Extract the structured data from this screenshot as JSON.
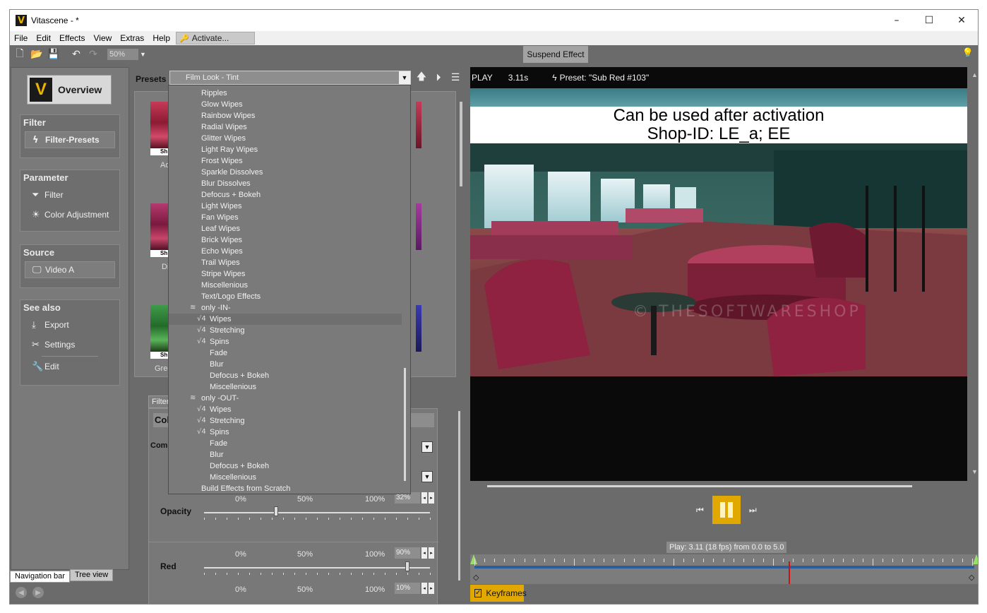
{
  "window": {
    "title": "Vitascene - *",
    "logo": "V",
    "controls": [
      "–",
      "☐",
      "✕"
    ]
  },
  "menu": [
    "File",
    "Edit",
    "Effects",
    "View",
    "Extras",
    "Help"
  ],
  "activate_label": "Activate...",
  "toolbar": {
    "zoom": "50%",
    "suspend_label": "Suspend Effect"
  },
  "nav": {
    "overview_label": "Overview",
    "groups": {
      "filter": {
        "title": "Filter",
        "items": [
          "Filter-Presets"
        ]
      },
      "parameter": {
        "title": "Parameter",
        "items": [
          "Filter",
          "Color Adjustment"
        ]
      },
      "source": {
        "title": "Source",
        "items": [
          "Video A"
        ]
      },
      "see_also": {
        "title": "See also",
        "items": [
          "Export",
          "Settings",
          "Edit"
        ]
      }
    },
    "tabs": [
      "Navigation bar",
      "Tree view"
    ]
  },
  "presets": {
    "label": "Presets",
    "selected": "Film Look - Tint",
    "thumb_caption": "Sh",
    "thumb_names": [
      "Ad",
      "Di",
      "Gree"
    ]
  },
  "dropdown": {
    "items": [
      {
        "text": "Ripples",
        "indent": 1
      },
      {
        "text": "Glow Wipes",
        "indent": 1
      },
      {
        "text": "Rainbow Wipes",
        "indent": 1
      },
      {
        "text": "Radial Wipes",
        "indent": 1
      },
      {
        "text": "Glitter Wipes",
        "indent": 1
      },
      {
        "text": "Light Ray Wipes",
        "indent": 1
      },
      {
        "text": "Frost Wipes",
        "indent": 1
      },
      {
        "text": "Sparkle Dissolves",
        "indent": 1
      },
      {
        "text": "Blur Dissolves",
        "indent": 1
      },
      {
        "text": "Defocus + Bokeh",
        "indent": 1
      },
      {
        "text": "Light Wipes",
        "indent": 1
      },
      {
        "text": "Fan Wipes",
        "indent": 1
      },
      {
        "text": "Leaf Wipes",
        "indent": 1
      },
      {
        "text": "Brick Wipes",
        "indent": 1
      },
      {
        "text": "Echo Wipes",
        "indent": 1
      },
      {
        "text": "Trail Wipes",
        "indent": 1
      },
      {
        "text": "Stripe Wipes",
        "indent": 1
      },
      {
        "text": "Miscellenious",
        "indent": 1
      },
      {
        "text": "Text/Logo Effects",
        "indent": 1
      },
      {
        "text": "only -IN-",
        "indent": 0,
        "icon": "stack"
      },
      {
        "text": "Wipes",
        "indent": 0,
        "icon": "v4",
        "highlight": true
      },
      {
        "text": "Stretching",
        "indent": 0,
        "icon": "v4"
      },
      {
        "text": "Spins",
        "indent": 0,
        "icon": "v4"
      },
      {
        "text": "Fade",
        "indent": 2
      },
      {
        "text": "Blur",
        "indent": 2
      },
      {
        "text": "Defocus + Bokeh",
        "indent": 2
      },
      {
        "text": "Miscellenious",
        "indent": 2
      },
      {
        "text": "only -OUT-",
        "indent": 0,
        "icon": "stack"
      },
      {
        "text": "Wipes",
        "indent": 0,
        "icon": "v4"
      },
      {
        "text": "Stretching",
        "indent": 0,
        "icon": "v4"
      },
      {
        "text": "Spins",
        "indent": 0,
        "icon": "v4"
      },
      {
        "text": "Fade",
        "indent": 2
      },
      {
        "text": "Blur",
        "indent": 2
      },
      {
        "text": "Defocus + Bokeh",
        "indent": 2
      },
      {
        "text": "Miscellenious",
        "indent": 2
      },
      {
        "text": "Build Effects from Scratch",
        "indent": 1
      }
    ]
  },
  "filter_panel": {
    "tab": "Filter",
    "header": "Col",
    "comp_label": "Comp",
    "sliders": [
      {
        "label": "Opacity",
        "value_text": "32%",
        "value": 0.32,
        "ticks": [
          "0%",
          "50%",
          "100%"
        ]
      },
      {
        "label": "Red",
        "value_text": "90%",
        "value": 0.9,
        "ticks": [
          "0%",
          "50%",
          "100%"
        ]
      },
      {
        "label": "",
        "value_text": "10%",
        "value": 0.1,
        "ticks": [
          "0%",
          "50%",
          "100%"
        ]
      }
    ]
  },
  "preview": {
    "mode": "PLAY",
    "time": "3.11s",
    "preset": "Preset: \"Sub Red #103\"",
    "banner_line1": "Can be used after activation",
    "banner_line2": "Shop-ID:  LE_a; EE",
    "watermark": "© THESOFTWARESHOP"
  },
  "transport": {
    "play_info": "Play: 3.11 (18 fps) from 0.0 to 5.0",
    "keyframes_label": "Keyframes",
    "keyframes_checked": "✓"
  },
  "colors": {
    "accent": "#e0a800",
    "timeline_bar": "#2c5f9a",
    "cursor": "#d01010",
    "panel": "#6b6b6b"
  }
}
